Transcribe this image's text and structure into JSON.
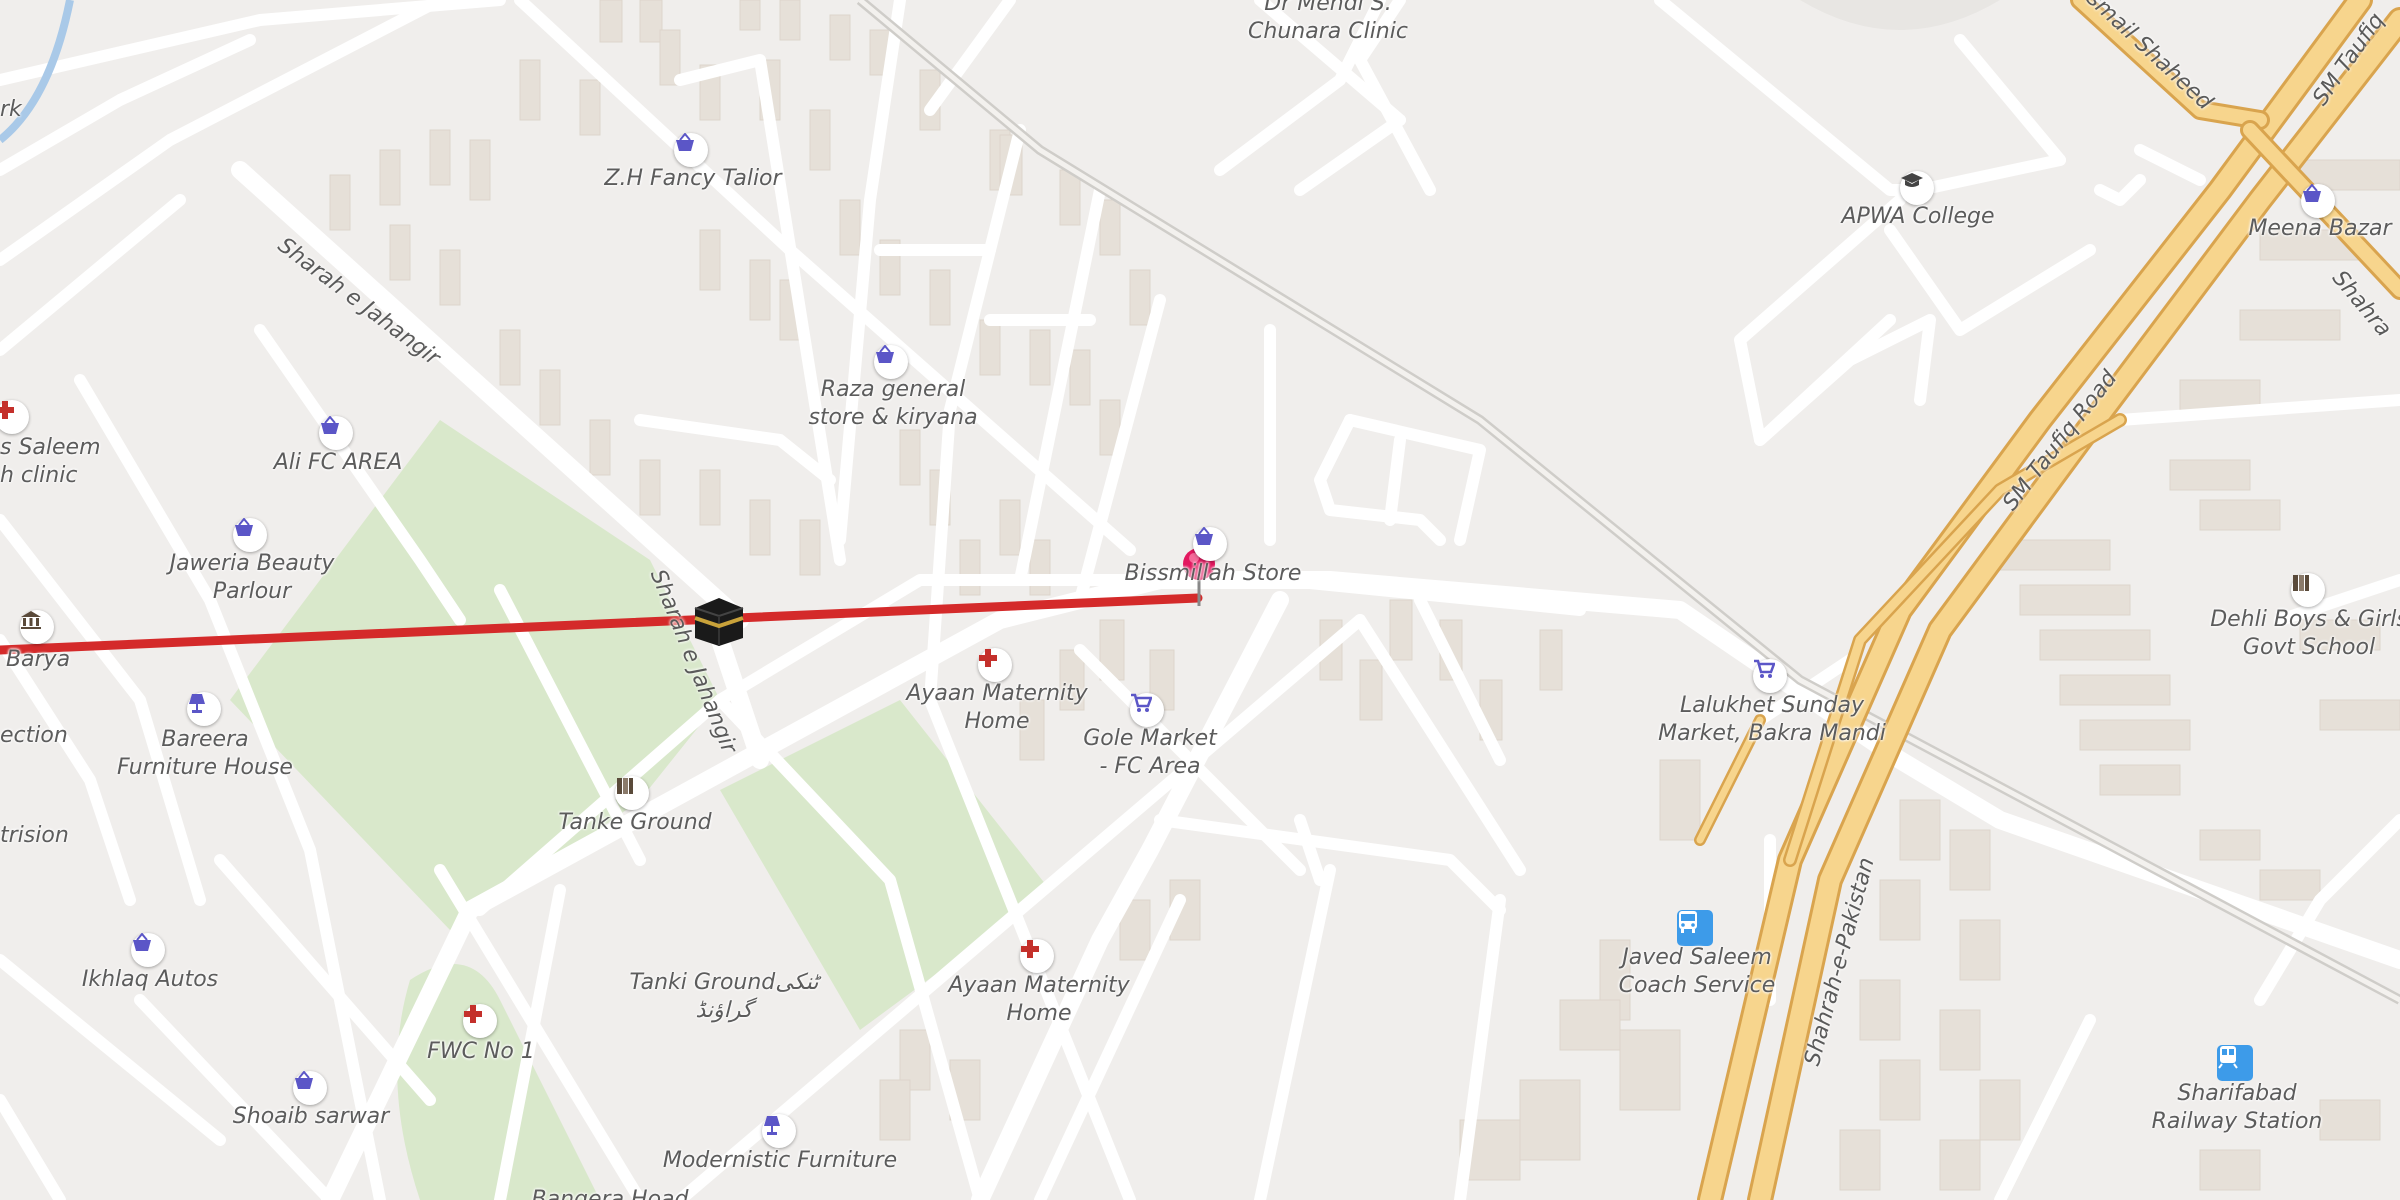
{
  "route_color": "#d42a2a",
  "poi_colors": {
    "shop": "#5b56c7",
    "medical": "#c4302b",
    "education": "#444444"
  },
  "places": [
    {
      "id": "zh",
      "lines": [
        "Z.H Fancy Talior"
      ],
      "icon": "basket-icon"
    },
    {
      "id": "raza",
      "lines": [
        "Raza general",
        "store & kiryana"
      ],
      "icon": "basket-icon"
    },
    {
      "id": "alifc",
      "lines": [
        "Ali FC AREA"
      ],
      "icon": "basket-icon"
    },
    {
      "id": "jaweria",
      "lines": [
        "Jaweria Beauty",
        "Parlour"
      ],
      "icon": "basket-icon"
    },
    {
      "id": "saleem",
      "lines": [
        "s Saleem",
        "h clinic"
      ],
      "icon": "medical-cross-icon"
    },
    {
      "id": "barya",
      "lines": [
        "Barya"
      ],
      "icon": "museum-icon"
    },
    {
      "id": "bareera",
      "lines": [
        "Bareera",
        "Furniture House"
      ],
      "icon": "lamp-icon"
    },
    {
      "id": "section",
      "lines": [
        "ection"
      ],
      "icon": ""
    },
    {
      "id": "trision",
      "lines": [
        "trision"
      ],
      "icon": ""
    },
    {
      "id": "rk",
      "lines": [
        "rk"
      ],
      "icon": ""
    },
    {
      "id": "ikhlaq",
      "lines": [
        "Ikhlaq Autos"
      ],
      "icon": "basket-icon"
    },
    {
      "id": "fwc",
      "lines": [
        "FWC No 1"
      ],
      "icon": "medical-cross-icon"
    },
    {
      "id": "shoaib",
      "lines": [
        "Shoaib sarwar"
      ],
      "icon": "basket-icon"
    },
    {
      "id": "tanke",
      "lines": [
        "Tanke Ground"
      ],
      "icon": "school-icon"
    },
    {
      "id": "tanki",
      "lines": [
        "Tanki Groundٹنکی",
        "گراؤنڈ"
      ],
      "icon": ""
    },
    {
      "id": "modernistic",
      "lines": [
        "Modernistic Furniture"
      ],
      "icon": "lamp-icon"
    },
    {
      "id": "bangera",
      "lines": [
        "Bangera Hoad"
      ],
      "icon": ""
    },
    {
      "id": "ayaan1",
      "lines": [
        "Ayaan Maternity",
        "Home"
      ],
      "icon": "medical-cross-icon"
    },
    {
      "id": "ayaan2",
      "lines": [
        "Ayaan Maternity",
        "Home"
      ],
      "icon": "medical-cross-icon"
    },
    {
      "id": "gole",
      "lines": [
        "Gole Market",
        "- FC Area"
      ],
      "icon": "cart-icon"
    },
    {
      "id": "bissmillah",
      "lines": [
        "Bissmillah Store"
      ],
      "icon": "basket-icon"
    },
    {
      "id": "chunara",
      "lines": [
        "Dr Mehdi S.",
        "Chunara Clinic"
      ],
      "icon": ""
    },
    {
      "id": "apwa",
      "lines": [
        "APWA College"
      ],
      "icon": "graduation-cap-icon"
    },
    {
      "id": "meena",
      "lines": [
        "Meena Bazar"
      ],
      "icon": "basket-icon"
    },
    {
      "id": "lalukhet",
      "lines": [
        "Lalukhet Sunday",
        "Market, Bakra Mandi"
      ],
      "icon": "cart-icon"
    },
    {
      "id": "dehli",
      "lines": [
        "Dehli Boys & Girls",
        "Govt School"
      ],
      "icon": "school-icon"
    },
    {
      "id": "javed",
      "lines": [
        "Javed Saleem",
        "Coach Service"
      ],
      "icon": "bus-icon"
    },
    {
      "id": "sharifabad",
      "lines": [
        "Sharifabad",
        "Railway Station"
      ],
      "icon": "train-icon"
    }
  ],
  "roads": [
    {
      "id": "jahangir1",
      "name": "Sharah e Jahangir"
    },
    {
      "id": "jahangir2",
      "name": "Sharah e Jahangir"
    },
    {
      "id": "taufiq",
      "name": "SM Taufiq Road"
    },
    {
      "id": "taufiq2",
      "name": "SM Taufiq"
    },
    {
      "id": "ismail",
      "name": "Ismail Shaheed"
    },
    {
      "id": "pakistan",
      "name": "Shahrah-e-Pakistan"
    },
    {
      "id": "shahrah",
      "name": "Shahra"
    }
  ]
}
